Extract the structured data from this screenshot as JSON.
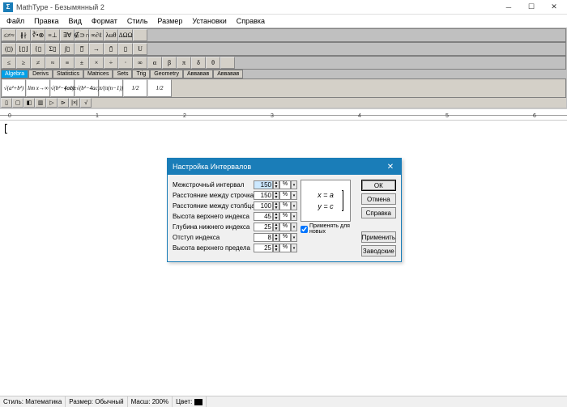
{
  "window": {
    "title": "MathType - Безымянный 2",
    "icon_text": "Σ"
  },
  "menu": [
    "Файл",
    "Правка",
    "Вид",
    "Формат",
    "Стиль",
    "Размер",
    "Установки",
    "Справка"
  ],
  "palette_rows": [
    [
      "≤≠≈",
      "∦∤",
      "∛•⊗",
      "≡⊥",
      "∃∀",
      "∉⊃∩",
      "∞∂ℓ",
      "λωθ",
      "ΔΩΩ",
      ""
    ],
    [
      "(▯)",
      "⌊▯⌋",
      "{▯",
      "Σ▯",
      "∫▯",
      "▯̅",
      "→",
      "▯̄",
      "▯",
      "U"
    ],
    [
      "≤",
      "≥",
      "≠",
      "≈",
      "≡",
      "±",
      "×",
      "÷",
      "·",
      "∞",
      "α",
      "β",
      "π",
      "δ",
      "θ",
      ""
    ]
  ],
  "tabs": [
    "Algebra",
    "Derivs",
    "Statistics",
    "Matrices",
    "Sets",
    "Trig",
    "Geometry",
    "Аввавав",
    "Аввавав"
  ],
  "templates": [
    "√(a²+b²)",
    "lim x→∞",
    "√(b²−4ac)",
    "(−b±√(b²−4ac))/2a",
    "π/(π(n−1))",
    "1/2",
    "1/2"
  ],
  "ruler_ticks": [
    "0",
    "1",
    "2",
    "3",
    "4",
    "5",
    "6"
  ],
  "dialog": {
    "title": "Настройка Интервалов",
    "rows": [
      {
        "label": "Межстрочный интервал",
        "value": "150"
      },
      {
        "label": "Расстояние между строчками",
        "value": "150"
      },
      {
        "label": "Расстояние между столбцами",
        "value": "100"
      },
      {
        "label": "Высота верхнего индекса",
        "value": "45"
      },
      {
        "label": "Глубина нижнего индекса",
        "value": "25"
      },
      {
        "label": "Отступ индекса",
        "value": "8"
      },
      {
        "label": "Высота верхнего предела",
        "value": "25"
      }
    ],
    "unit": "%",
    "preview_lines": [
      "x = a",
      "y = c"
    ],
    "checkbox": "Применять для новых",
    "buttons": {
      "ok": "ОК",
      "cancel": "Отмена",
      "help": "Справка",
      "apply": "Применить",
      "factory": "Заводские"
    }
  },
  "status": {
    "style_label": "Стиль:",
    "style_value": "Математика",
    "size_label": "Размер:",
    "size_value": "Обычный",
    "zoom_label": "Масш:",
    "zoom_value": "200%",
    "color_label": "Цвет:"
  }
}
